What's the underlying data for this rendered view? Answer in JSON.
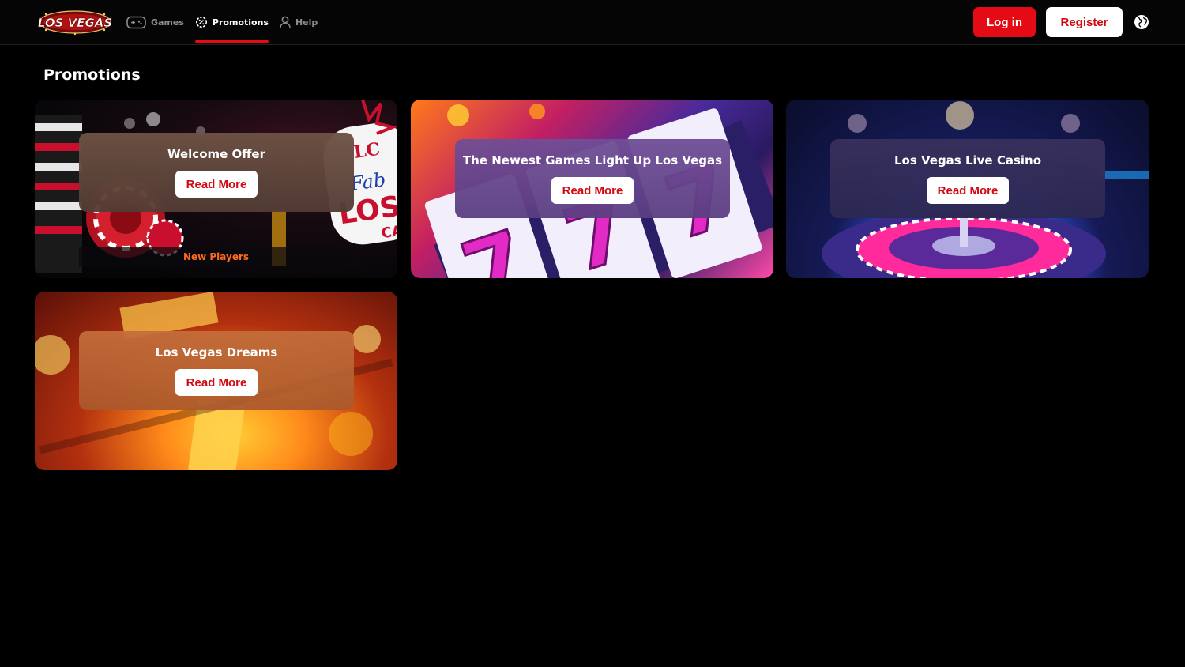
{
  "header": {
    "logo_text": "LOS VEGAS",
    "nav": [
      {
        "label": "Games",
        "icon": "gamepad-icon",
        "active": false
      },
      {
        "label": "Promotions",
        "icon": "gear-badge-icon",
        "active": true
      },
      {
        "label": "Help",
        "icon": "person-icon",
        "active": false
      }
    ],
    "login_label": "Log in",
    "register_label": "Register",
    "language_icon": "globe-icon"
  },
  "page": {
    "title": "Promotions"
  },
  "promotions": [
    {
      "title": "Welcome Offer",
      "button": "Read More",
      "tag": "New Players",
      "theme": "casino-chips-sign"
    },
    {
      "title": "The Newest Games Light Up Los Vegas",
      "button": "Read More",
      "theme": "slot-machine-777"
    },
    {
      "title": "Los Vegas Live Casino",
      "button": "Read More",
      "theme": "roulette-wheel"
    },
    {
      "title": "Los Vegas Dreams",
      "button": "Read More",
      "theme": "golden-slot-reels"
    }
  ],
  "colors": {
    "brand_red": "#e50b14",
    "background": "#000000",
    "tag_orange": "#ff6a1a"
  }
}
